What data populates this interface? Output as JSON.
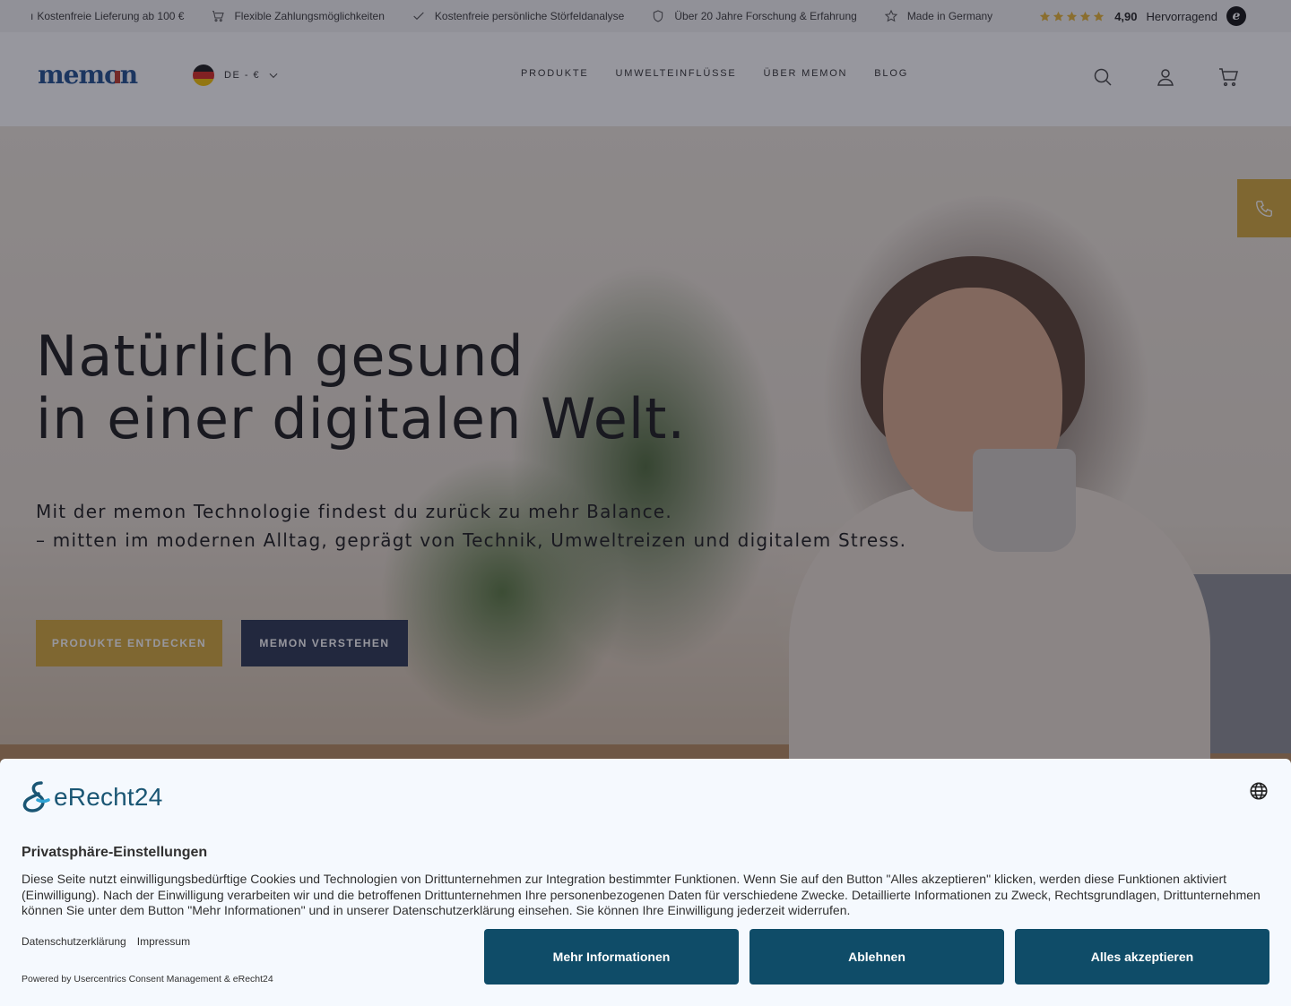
{
  "topbar": {
    "leading_fragment": "ı",
    "usps": [
      {
        "icon": "truck-icon",
        "label": "Kostenfreie Lieferung ab 100 €"
      },
      {
        "icon": "cart-icon",
        "label": "Flexible Zahlungsmöglichkeiten"
      },
      {
        "icon": "check-icon",
        "label": "Kostenfreie persönliche Störfeldanalyse"
      },
      {
        "icon": "shield-icon",
        "label": "Über 20 Jahre Forschung & Erfahrung"
      },
      {
        "icon": "star-outline-icon",
        "label": "Made in Germany"
      }
    ],
    "rating": {
      "score": "4,90",
      "label": "Hervorragend",
      "stars": 5,
      "badge": "e"
    }
  },
  "header": {
    "logo_text": "memon",
    "locale": "DE - €",
    "nav": [
      "Produkte",
      "Umwelteinflüsse",
      "Über memon",
      "Blog"
    ],
    "icons": [
      "search-icon",
      "user-icon",
      "cart-icon"
    ]
  },
  "hero": {
    "title_line1": "Natürlich gesund",
    "title_line2": "in einer digitalen Welt.",
    "subtitle_line1": "Mit der memon Technologie findest du zurück zu mehr Balance.",
    "subtitle_line2": "– mitten im modernen Alltag, geprägt von Technik, Umweltreizen und digitalem Stress.",
    "primary_button": "PRODUKTE ENTDECKEN",
    "secondary_button": "MEMON VERSTEHEN"
  },
  "consent": {
    "brand": "eRecht24",
    "title": "Privatsphäre-Einstellungen",
    "text": "Diese Seite nutzt einwilligungsbedürftige Cookies und Technologien von Drittunternehmen zur Integration bestimmter Funktionen. Wenn Sie auf den Button \"Alles akzeptieren\" klicken, werden diese Funktionen aktiviert (Einwilligung). Nach der Einwilligung verarbeiten wir und die betroffenen Drittunternehmen Ihre personenbezogenen Daten für verschiedene Zwecke. Detaillierte Informationen zu Zweck, Rechtsgrundlagen, Drittunternehmen können Sie unter dem Button \"Mehr Informationen\" und in unserer Datenschutzerklärung einsehen. Sie können Ihre Einwilligung jederzeit widerrufen.",
    "links": [
      "Datenschutzerklärung",
      "Impressum"
    ],
    "powered_by": "Powered by Usercentrics Consent Management & eRecht24",
    "buttons": [
      "Mehr Informationen",
      "Ablehnen",
      "Alles akzeptieren"
    ]
  },
  "colors": {
    "gold": "#d4a83a",
    "navy": "#2a3550",
    "consent_button": "#0f4c68",
    "logo_blue": "#1f4f8f",
    "logo_red": "#c0392b"
  }
}
